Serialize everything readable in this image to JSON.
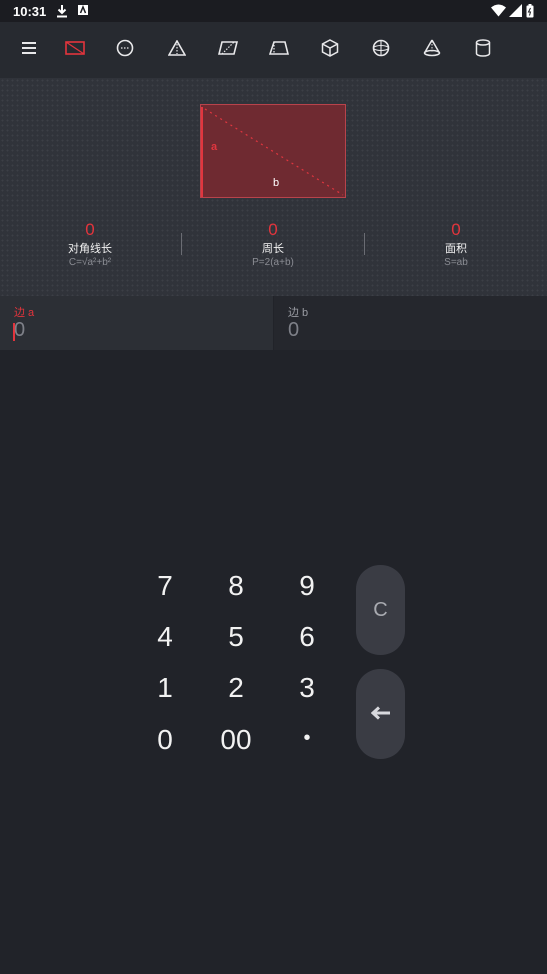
{
  "status_bar": {
    "time": "10:31"
  },
  "toolbar": {
    "icons": [
      "menu-icon",
      "rectangle-icon",
      "circle-icon",
      "triangle-icon",
      "parallelogram-icon",
      "trapezoid-icon",
      "cube-icon",
      "sphere-icon",
      "cone-icon",
      "cylinder-icon"
    ],
    "active_index": 1
  },
  "figure": {
    "label_a": "a",
    "label_b": "b"
  },
  "results": [
    {
      "value": "0",
      "name": "对角线长",
      "formula": "C=√a²+b²"
    },
    {
      "value": "0",
      "name": "周长",
      "formula": "P=2(a+b)"
    },
    {
      "value": "0",
      "name": "面积",
      "formula": "S=ab"
    }
  ],
  "inputs": [
    {
      "label": "边 a",
      "value": "0"
    },
    {
      "label": "边 b",
      "value": "0"
    }
  ],
  "keypad": {
    "keys": [
      "7",
      "8",
      "9",
      "4",
      "5",
      "6",
      "1",
      "2",
      "3",
      "0",
      "00",
      "•"
    ],
    "clear_label": "C",
    "backspace_icon": "backspace-arrow-icon"
  },
  "colors": {
    "accent": "#e3343c",
    "background": "#212329",
    "panel": "#30333a"
  }
}
